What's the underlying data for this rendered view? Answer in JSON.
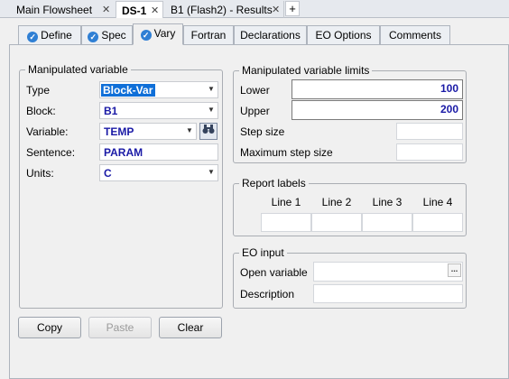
{
  "doc_tabs": [
    {
      "label": "Main Flowsheet",
      "active": false
    },
    {
      "label": "DS-1",
      "active": true
    },
    {
      "label": "B1 (Flash2) - Results",
      "active": false
    }
  ],
  "new_tab_label": "+",
  "close_glyph": "✕",
  "form_tabs": [
    {
      "label": "Define",
      "check": true
    },
    {
      "label": "Spec",
      "check": true
    },
    {
      "label": "Vary",
      "check": true,
      "active": true
    },
    {
      "label": "Fortran",
      "check": false
    },
    {
      "label": "Declarations",
      "check": false
    },
    {
      "label": "EO Options",
      "check": false
    },
    {
      "label": "Comments",
      "check": false
    }
  ],
  "manipulated_variable": {
    "title": "Manipulated variable",
    "type_label": "Type",
    "type_value": "Block-Var",
    "block_label": "Block:",
    "block_value": "B1",
    "variable_label": "Variable:",
    "variable_value": "TEMP",
    "sentence_label": "Sentence:",
    "sentence_value": "PARAM",
    "units_label": "Units:",
    "units_value": "C"
  },
  "limits": {
    "title": "Manipulated variable limits",
    "lower_label": "Lower",
    "lower_value": "100",
    "upper_label": "Upper",
    "upper_value": "200",
    "step_label": "Step size",
    "step_value": "",
    "max_step_label": "Maximum step size",
    "max_step_value": ""
  },
  "report_labels": {
    "title": "Report labels",
    "lines": [
      "Line 1",
      "Line 2",
      "Line 3",
      "Line 4"
    ]
  },
  "eo_input": {
    "title": "EO input",
    "open_variable_label": "Open variable",
    "open_variable_value": "",
    "description_label": "Description",
    "description_value": "",
    "browse_glyph": "..."
  },
  "buttons": {
    "copy": "Copy",
    "paste": "Paste",
    "clear": "Clear"
  },
  "icons": {
    "check": "check-circle-icon",
    "dropdown": "chevron-down-icon",
    "find": "binoculars-icon"
  }
}
